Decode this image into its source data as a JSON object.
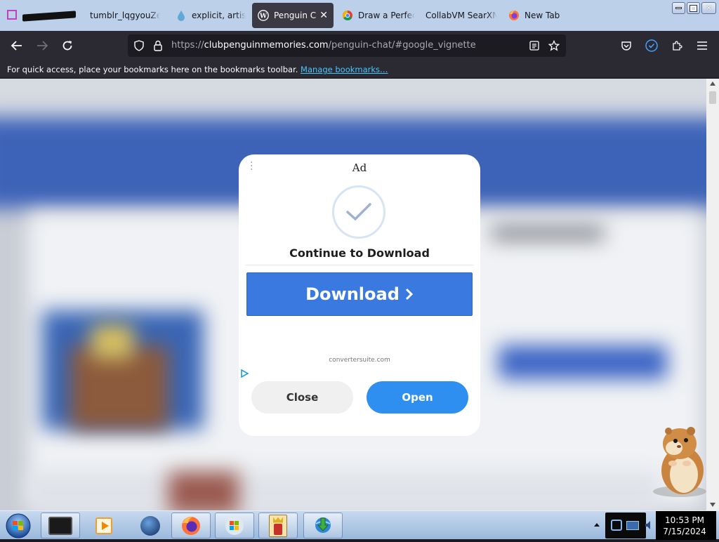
{
  "tabs": [
    {
      "label": "tumblr_lqgyouZeL",
      "icon": "tumblr-icon"
    },
    {
      "label": "explicit, artist:",
      "icon": "drop-icon"
    },
    {
      "label": "Penguin C",
      "icon": "wordpress-icon",
      "active": true
    },
    {
      "label": "Draw a Perfect",
      "icon": "chrome-icon"
    },
    {
      "label": "CollabVM SearXNG",
      "icon": "none"
    },
    {
      "label": "New Tab",
      "icon": "firefox-icon"
    }
  ],
  "nav": {
    "url_prefix": "https://",
    "url_domain": "clubpenguinmemories.com",
    "url_path": "/penguin-chat/#google_vignette"
  },
  "bookmarks": {
    "message": "For quick access, place your bookmarks here on the bookmarks toolbar.",
    "manage_link": "Manage bookmarks…"
  },
  "ad": {
    "label": "Ad",
    "title": "Continue to Download",
    "download_button": "Download",
    "domain": "convertersuite.com",
    "close_button": "Close",
    "open_button": "Open"
  },
  "taskbar": {
    "time": "10:53 PM",
    "date": "7/15/2024"
  },
  "colors": {
    "download_button": "#3a7ae0",
    "open_button": "#2f8ff0",
    "link": "#44c8ff",
    "tabstrip": "#bcd0ea"
  }
}
